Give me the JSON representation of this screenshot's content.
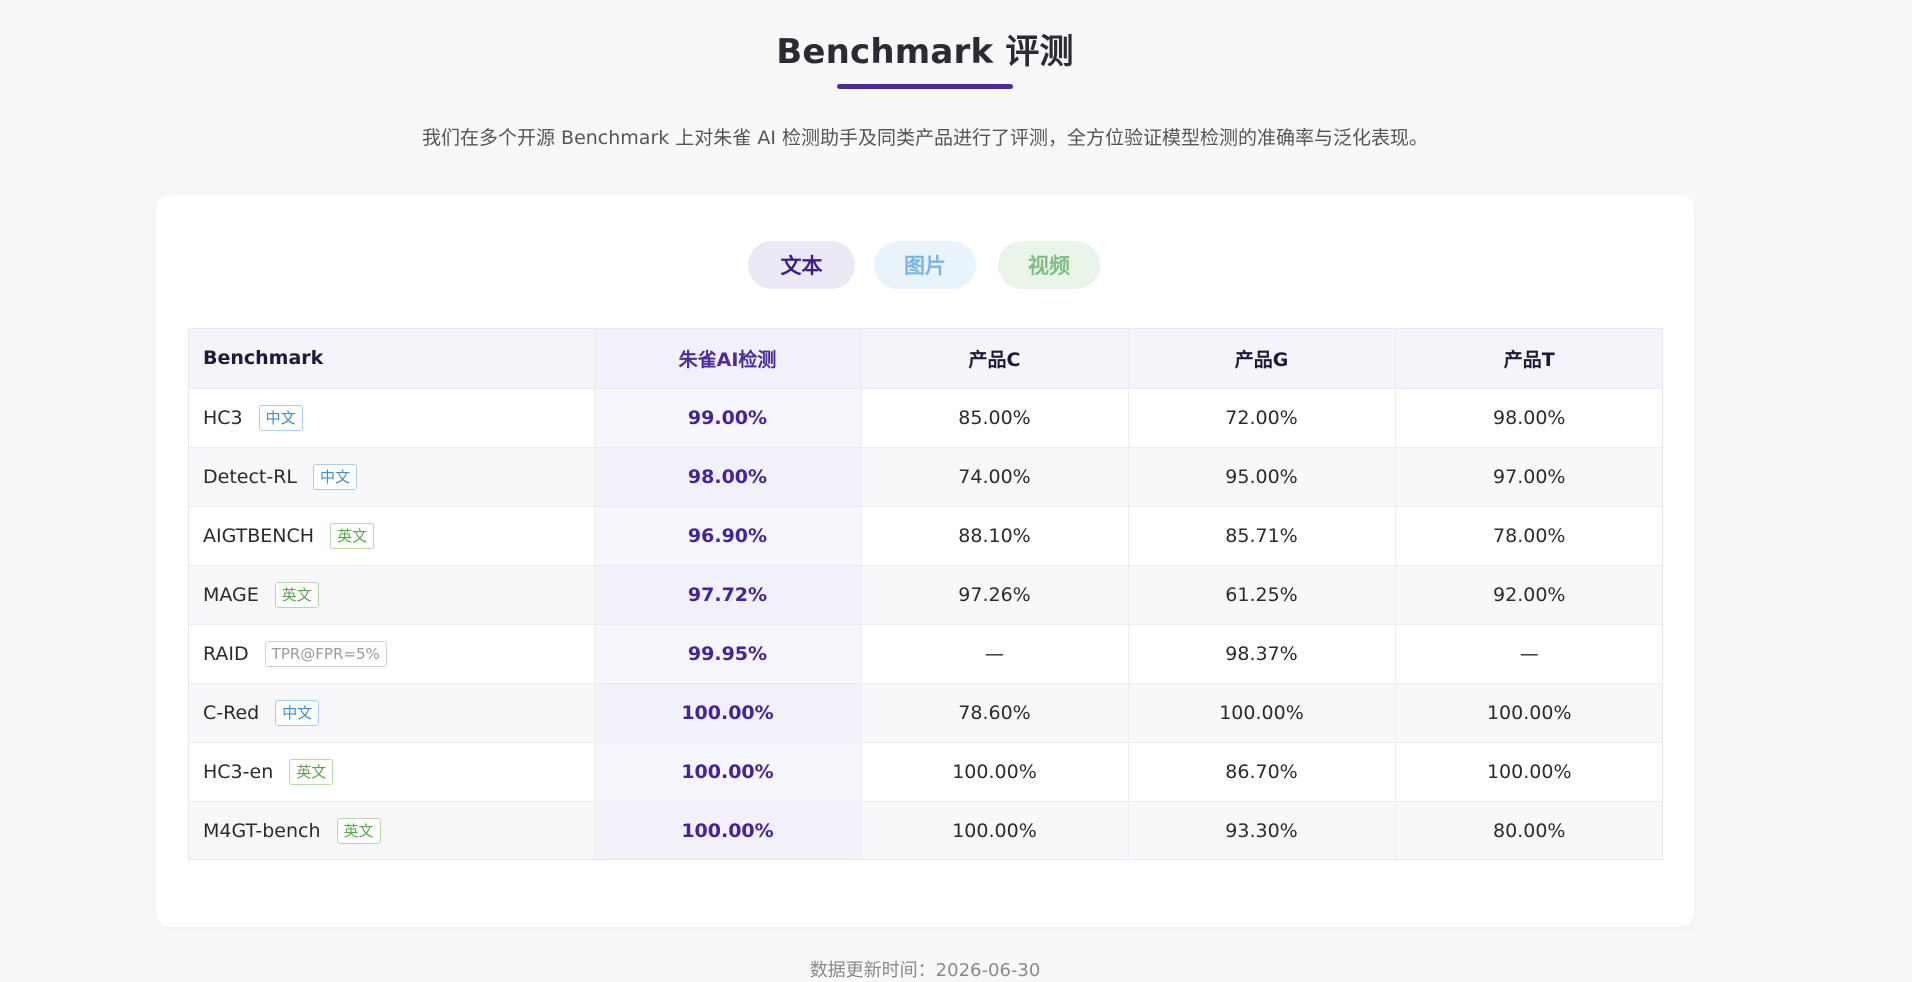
{
  "header": {
    "title": "Benchmark 评测",
    "subtitle": "我们在多个开源 Benchmark 上对朱雀 AI 检测助手及同类产品进行了评测，全方位验证模型检测的准确率与泛化表现。"
  },
  "tabs": [
    {
      "label": "文本",
      "active": true
    },
    {
      "label": "图片",
      "active": false
    },
    {
      "label": "视频",
      "active": false
    }
  ],
  "table": {
    "columns": [
      "Benchmark",
      "朱雀AI检测",
      "产品C",
      "产品G",
      "产品T"
    ],
    "rows": [
      {
        "name": "HC3",
        "tag": "中文",
        "tag_type": "zh",
        "values": [
          "99.00%",
          "85.00%",
          "72.00%",
          "98.00%"
        ]
      },
      {
        "name": "Detect-RL",
        "tag": "中文",
        "tag_type": "zh",
        "values": [
          "98.00%",
          "74.00%",
          "95.00%",
          "97.00%"
        ]
      },
      {
        "name": "AIGTBENCH",
        "tag": "英文",
        "tag_type": "en",
        "values": [
          "96.90%",
          "88.10%",
          "85.71%",
          "78.00%"
        ]
      },
      {
        "name": "MAGE",
        "tag": "英文",
        "tag_type": "en",
        "values": [
          "97.72%",
          "97.26%",
          "61.25%",
          "92.00%"
        ]
      },
      {
        "name": "RAID",
        "tag": "TPR@FPR=5%",
        "tag_type": "metric",
        "values": [
          "99.95%",
          "—",
          "98.37%",
          "—"
        ]
      },
      {
        "name": "C-Red",
        "tag": "中文",
        "tag_type": "zh",
        "values": [
          "100.00%",
          "78.60%",
          "100.00%",
          "100.00%"
        ]
      },
      {
        "name": "HC3-en",
        "tag": "英文",
        "tag_type": "en",
        "values": [
          "100.00%",
          "100.00%",
          "86.70%",
          "100.00%"
        ]
      },
      {
        "name": "M4GT-bench",
        "tag": "英文",
        "tag_type": "en",
        "values": [
          "100.00%",
          "100.00%",
          "93.30%",
          "80.00%"
        ]
      }
    ]
  },
  "footer": {
    "updated": "数据更新时间：2026-06-30"
  },
  "colors": {
    "accent": "#4b2ca0",
    "tag_zh": "#3d8ed6",
    "tag_en": "#58a84a"
  }
}
